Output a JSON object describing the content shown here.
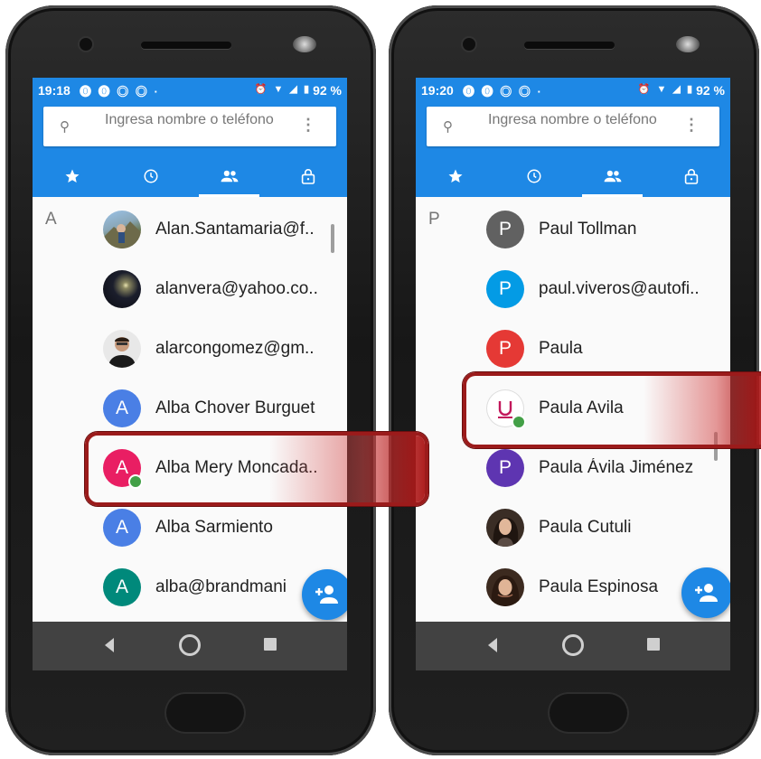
{
  "left": {
    "status": {
      "time": "19:18",
      "battery": "92 %"
    },
    "search": {
      "placeholder": "Ingresa nombre o teléfono"
    },
    "section_letter": "A",
    "contacts": [
      {
        "name": "Alan.Santamaria@f..",
        "avatar": "photo"
      },
      {
        "name": "alanvera@yahoo.co..",
        "avatar": "photo"
      },
      {
        "name": "alarcongomez@gm..",
        "avatar": "photo"
      },
      {
        "name": "Alba Chover Burguet",
        "avatar": "A",
        "color": "#4a7fe5"
      },
      {
        "name": "Alba Mery Moncada..",
        "avatar": "A",
        "color": "#e91e63",
        "online": true
      },
      {
        "name": "Alba Sarmiento",
        "avatar": "A",
        "color": "#4a7fe5"
      },
      {
        "name": "alba@brandmani",
        "avatar": "A",
        "color": "#00897b"
      }
    ]
  },
  "right": {
    "status": {
      "time": "19:20",
      "battery": "92 %"
    },
    "search": {
      "placeholder": "Ingresa nombre o teléfono"
    },
    "section_letter": "P",
    "contacts": [
      {
        "name": "Paul Tollman",
        "avatar": "P",
        "color": "#616161"
      },
      {
        "name": "paul.viveros@autofi..",
        "avatar": "P",
        "color": "#039be5"
      },
      {
        "name": "Paula",
        "avatar": "P",
        "color": "#e53935"
      },
      {
        "name": "Paula Avila",
        "avatar": "U-logo",
        "online": true
      },
      {
        "name": "Paula Ávila Jiménez",
        "avatar": "P",
        "color": "#5e35b1"
      },
      {
        "name": "Paula Cutuli",
        "avatar": "photo"
      },
      {
        "name": "Paula Espinosa",
        "avatar": "photo"
      }
    ]
  },
  "tabs": [
    "star-icon",
    "clock-icon",
    "people-icon",
    "lock-icon"
  ],
  "colors": {
    "accent": "#1e88e5",
    "highlight": "#9b1b1b"
  }
}
